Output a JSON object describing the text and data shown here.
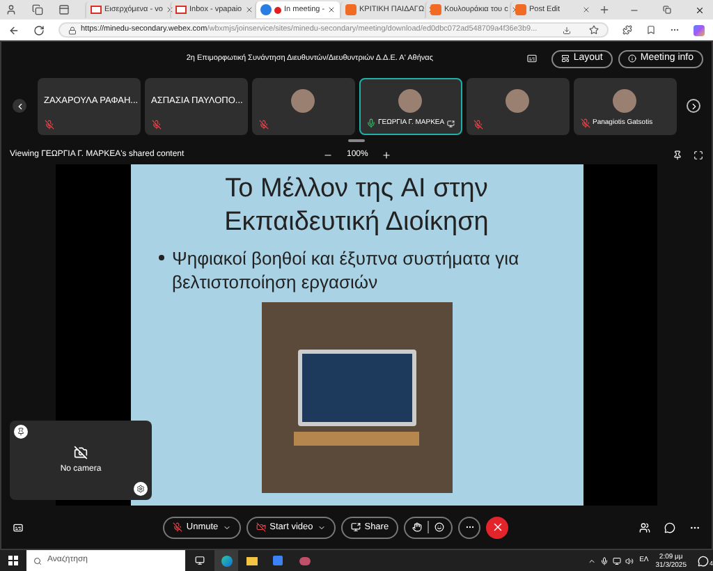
{
  "browser": {
    "tabs": [
      {
        "title": "Εισερχόμενα - vo",
        "kind": "mail",
        "recording": false,
        "selected": false
      },
      {
        "title": "Inbox - vpapaio",
        "kind": "mail",
        "recording": false,
        "selected": false
      },
      {
        "title": "In meeting -",
        "kind": "meeting",
        "recording": true,
        "selected": true
      },
      {
        "title": "ΚΡΙΤΙΚΗ ΠΑΙΔΑΓΩ",
        "kind": "doc",
        "recording": false,
        "selected": false
      },
      {
        "title": "Κουλουράκια του c",
        "kind": "doc",
        "recording": false,
        "selected": false
      },
      {
        "title": "Post Edit",
        "kind": "doc",
        "recording": false,
        "selected": false
      }
    ],
    "url_host": "https://minedu-secondary.webex.com",
    "url_path": "/wbxmjs/joinservice/sites/minedu-secondary/meeting/download/ed0dbc072ad548709a4f36e3b9..."
  },
  "meeting": {
    "title": "2η Επιμορφωτική Συνάντηση Διευθυντών/Διευθυντριών Δ.Δ.Ε. Α' Αθήνας",
    "layout_button": "Layout",
    "info_button": "Meeting info"
  },
  "participants": [
    {
      "kind": "name",
      "name": "ΖΑΧΑΡΟΥΛΑ ΡΑΦΑΗ...",
      "muted": true,
      "sharing": false,
      "selected": false
    },
    {
      "kind": "name",
      "name": "ΑΣΠΑΣΙΑ ΠΑΥΛΟΠΟ...",
      "muted": true,
      "sharing": false,
      "selected": false
    },
    {
      "kind": "avatar",
      "muted": true,
      "sharing": false,
      "selected": false
    },
    {
      "kind": "avatar",
      "name": "ΓΕΩΡΓΙΑ Γ. ΜΑΡΚΕΑ",
      "muted": false,
      "sharing": true,
      "selected": true
    },
    {
      "kind": "avatar",
      "muted": true,
      "sharing": false,
      "selected": false
    },
    {
      "kind": "avatar",
      "name": "Panagiotis Gatsotis",
      "muted": true,
      "sharing": false,
      "selected": false
    }
  ],
  "share": {
    "viewing": "Viewing ΓΕΩΡΓΙΑ Γ. ΜΑΡΚΕΑ's shared content",
    "zoom": "100%"
  },
  "slide": {
    "title": "Το Μέλλον της AI στην Εκπαιδευτική Διοίκηση",
    "bullet": "Ψηφιακοί βοηθοί και έξυπνα συστήματα για βελτιστοποίηση εργασιών"
  },
  "self_view": {
    "label": "No camera"
  },
  "controls": {
    "audio": {
      "label": "Unmute",
      "muted": true
    },
    "video": {
      "label": "Start video",
      "off": true
    },
    "share": "Share"
  },
  "taskbar": {
    "search_placeholder": "Αναζήτηση",
    "language": "ΕΛ",
    "time": "2:09 μμ",
    "date": "31/3/2025",
    "notifications": "4"
  }
}
